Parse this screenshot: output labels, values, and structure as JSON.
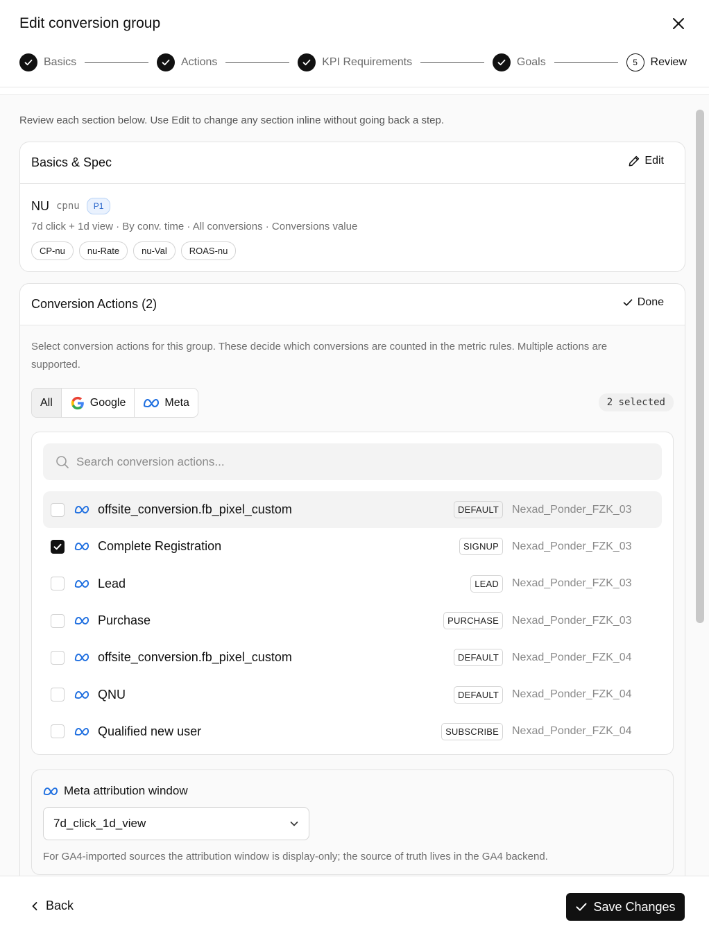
{
  "modal": {
    "title": "Edit conversion group"
  },
  "stepper": {
    "steps": [
      {
        "label": "Basics",
        "state": "done"
      },
      {
        "label": "Actions",
        "state": "done"
      },
      {
        "label": "KPI Requirements",
        "state": "done"
      },
      {
        "label": "Goals",
        "state": "done"
      },
      {
        "label": "Review",
        "state": "current",
        "number": "5"
      }
    ]
  },
  "intro": "Review each section below. Use Edit to change any section inline without going back a step.",
  "basics": {
    "title": "Basics & Spec",
    "edit_label": "Edit",
    "code": "NU",
    "sub": "cpnu",
    "priority": "P1",
    "description": "7d click + 1d view · By conv. time · All conversions · Conversions value",
    "chips": [
      "CP-nu",
      "nu-Rate",
      "nu-Val",
      "ROAS-nu"
    ]
  },
  "actions": {
    "title": "Conversion Actions (2)",
    "done_label": "Done",
    "description": "Select conversion actions for this group. These decide which conversions are counted in the metric rules. Multiple actions are supported.",
    "filters": {
      "all": "All",
      "google": "Google",
      "meta": "Meta"
    },
    "selected_count": "2 selected",
    "search": {
      "placeholder": "Search conversion actions..."
    },
    "rows": [
      {
        "name": "offsite_conversion.fb_pixel_custom",
        "tag": "DEFAULT",
        "account": "Nexad_Ponder_FZK_03",
        "checked": false
      },
      {
        "name": "Complete Registration",
        "tag": "SIGNUP",
        "account": "Nexad_Ponder_FZK_03",
        "checked": true
      },
      {
        "name": "Lead",
        "tag": "LEAD",
        "account": "Nexad_Ponder_FZK_03",
        "checked": false
      },
      {
        "name": "Purchase",
        "tag": "PURCHASE",
        "account": "Nexad_Ponder_FZK_03",
        "checked": false
      },
      {
        "name": "offsite_conversion.fb_pixel_custom",
        "tag": "DEFAULT",
        "account": "Nexad_Ponder_FZK_04",
        "checked": false
      },
      {
        "name": "QNU",
        "tag": "DEFAULT",
        "account": "Nexad_Ponder_FZK_04",
        "checked": false
      },
      {
        "name": "Qualified new user",
        "tag": "SUBSCRIBE",
        "account": "Nexad_Ponder_FZK_04",
        "checked": false
      }
    ]
  },
  "attribution": {
    "title": "Meta attribution window",
    "value": "7d_click_1d_view",
    "note": "For GA4-imported sources the attribution window is display-only; the source of truth lives in the GA4 backend."
  },
  "footer": {
    "back_label": "Back",
    "save_label": "Save Changes"
  },
  "colors": {
    "primary": "#111111",
    "meta_blue": "#1f6fe0",
    "badge_blue": "#2563c9"
  }
}
